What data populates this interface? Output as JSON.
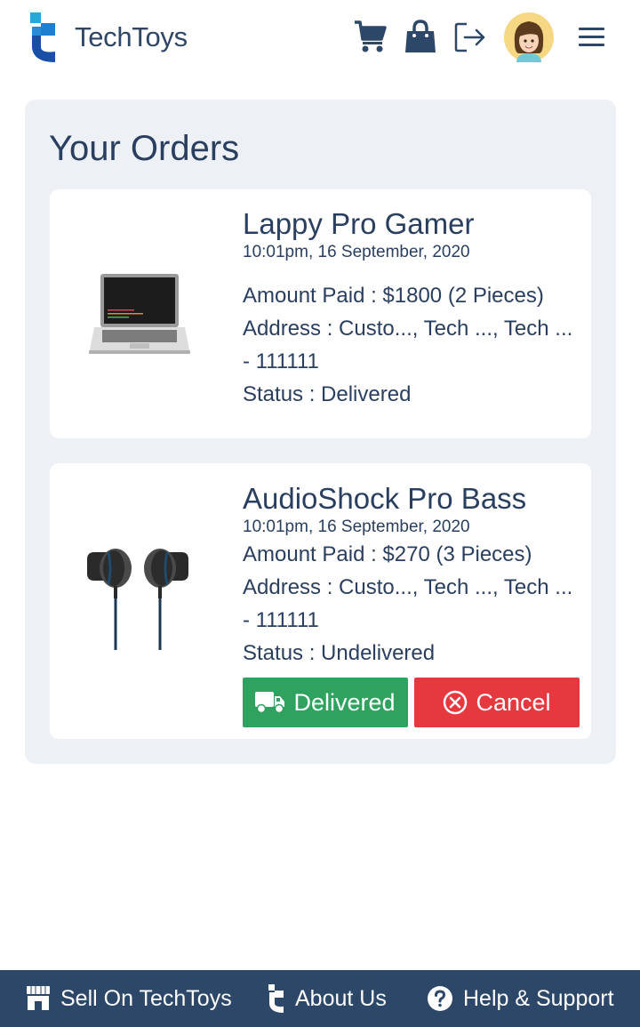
{
  "header": {
    "brand": "TechToys",
    "icons": [
      "techtoys-logo-icon",
      "cart-icon",
      "shopping-bag-icon",
      "logout-icon",
      "avatar",
      "menu-icon"
    ]
  },
  "orders": {
    "title": "Your Orders",
    "items": [
      {
        "name": "Lappy Pro Gamer",
        "date": "10:01pm, 16 September, 2020",
        "amount": "Amount Paid : $1800 (2 Pieces)",
        "address": "Address : Custo..., Tech ..., Tech ... - 111111",
        "status": "Status : Delivered",
        "image_icon": "laptop-icon"
      },
      {
        "name": "AudioShock Pro Bass",
        "date": "10:01pm, 16 September, 2020",
        "amount": "Amount Paid : $270 (3 Pieces)",
        "address": "Address : Custo..., Tech ..., Tech ... - 111111",
        "status": "Status : Undelivered",
        "image_icon": "earphones-icon",
        "actions": {
          "delivered_label": "Delivered",
          "cancel_label": "Cancel"
        }
      }
    ]
  },
  "footer": {
    "sell_label": "Sell On TechToys",
    "about_label": "About Us",
    "help_label": "Help & Support"
  },
  "colors": {
    "brand_navy": "#2d4768",
    "panel_bg": "#edf1f5",
    "delivered_green": "#30a25f",
    "cancel_red": "#e5383f"
  }
}
